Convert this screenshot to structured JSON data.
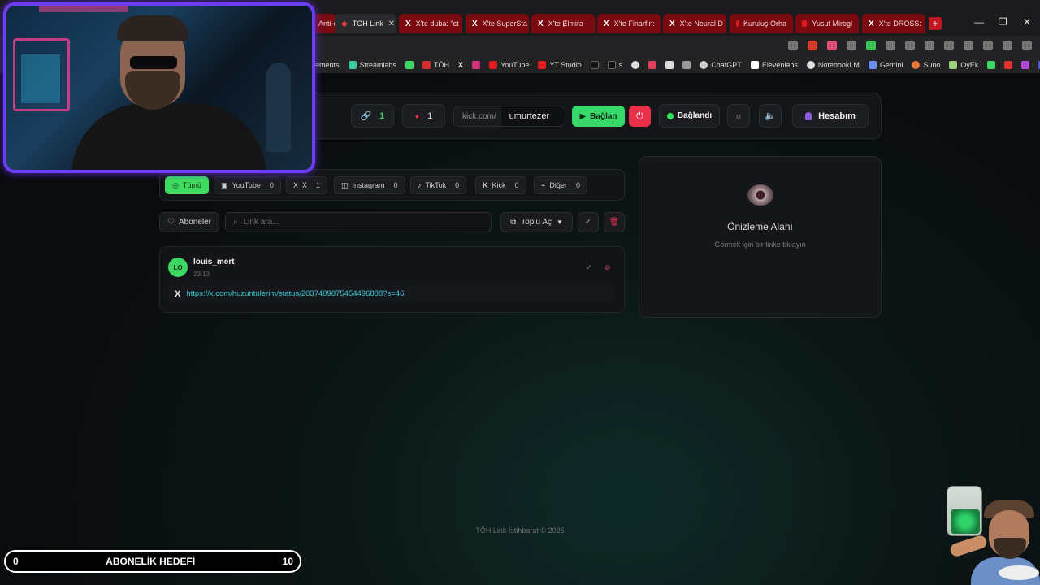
{
  "browser": {
    "tabs": [
      {
        "label": "Anti-c",
        "kind": "red"
      },
      {
        "label": "TÖH Link",
        "kind": "active"
      },
      {
        "label": "X'te duba: \"ct",
        "kind": "x"
      },
      {
        "label": "X'te SuperSta",
        "kind": "x"
      },
      {
        "label": "X'te Ɇlmira",
        "kind": "x"
      },
      {
        "label": "X'te Finarfin:",
        "kind": "x"
      },
      {
        "label": "X'te Neural D",
        "kind": "x"
      },
      {
        "label": "Kuruluş Orha",
        "kind": "yt"
      },
      {
        "label": "Yusuf Mirogl",
        "kind": "yt"
      },
      {
        "label": "X'te DROSS:",
        "kind": "x"
      }
    ],
    "bookmarks": [
      "ements",
      "Streamlabs",
      "",
      "TÖH",
      "",
      "",
      "YouTube",
      "YT Studio",
      "",
      "s",
      "",
      "",
      "",
      "",
      "ChatGPT",
      "Elevenlabs",
      "NotebookLM",
      "Gemini",
      "Suno",
      "OyEk",
      "",
      ""
    ],
    "accent": "#7a0a10"
  },
  "toolbar": {
    "links_count": "1",
    "errors_count": "1",
    "kick_prefix": "kick.com/",
    "channel_value": "umurtezer",
    "connect_label": "Bağlan",
    "status_label": "Bağlandı",
    "account_label": "Hesabım"
  },
  "filters": {
    "tabs": [
      {
        "label": "Tümü",
        "count": "",
        "icon": "globe-icon",
        "active": true
      },
      {
        "label": "YouTube",
        "count": "0",
        "icon": "youtube-icon"
      },
      {
        "label": "X",
        "count": "1",
        "icon": "x-icon"
      },
      {
        "label": "Instagram",
        "count": "0",
        "icon": "instagram-icon"
      },
      {
        "label": "TikTok",
        "count": "0",
        "icon": "tiktok-icon"
      },
      {
        "label": "Kick",
        "count": "0",
        "icon": "kick-icon"
      },
      {
        "label": "Diğer",
        "count": "0",
        "icon": "link-icon"
      }
    ]
  },
  "actions": {
    "subscribers_label": "Aboneler",
    "search_placeholder": "Link ara...",
    "bulk_open_label": "Toplu Aç"
  },
  "message": {
    "avatar_initials": "LO",
    "username": "louis_mert",
    "time": "23:13",
    "link": "https://x.com/huzuntulerim/status/2037409875454496888?s=46"
  },
  "preview": {
    "title": "Önizleme Alanı",
    "subtitle": "Görmek için bir linke tıklayın"
  },
  "footer": {
    "text": "TÖH Link İstihbarat © 2025"
  },
  "overlay": {
    "goal_start": "0",
    "goal_label": "ABONELİK HEDEFİ",
    "goal_end": "10"
  },
  "colors": {
    "accent_green": "#39d86a",
    "danger": "#ea2f4b",
    "link": "#38c9d8"
  }
}
